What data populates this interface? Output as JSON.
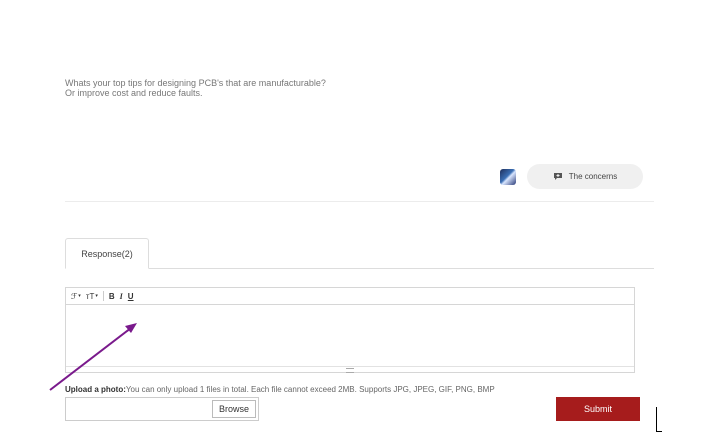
{
  "question": {
    "line1": "Whats your top tips for designing PCB's that are manufacturable?",
    "line2": "Or improve cost and reduce faults."
  },
  "actions": {
    "concerns_label": "The concerns"
  },
  "tabs": [
    {
      "label": "Response(2)",
      "active": true
    }
  ],
  "editor": {
    "toolbar": {
      "font_family_glyph": "ℱ",
      "font_size_glyph": "ᴛT",
      "dropdown_glyph": "▾",
      "bold": "B",
      "italic": "I",
      "underline": "U"
    },
    "content": ""
  },
  "upload": {
    "label": "Upload a photo:",
    "hint": "You can only upload 1 files in total. Each file cannot exceed 2MB. Supports JPG, JPEG, GIF, PNG, BMP",
    "browse_label": "Browse",
    "file_value": ""
  },
  "submit_label": "Submit",
  "colors": {
    "submit": "#a61c1c",
    "annotation_arrow": "#7a1a8c"
  }
}
